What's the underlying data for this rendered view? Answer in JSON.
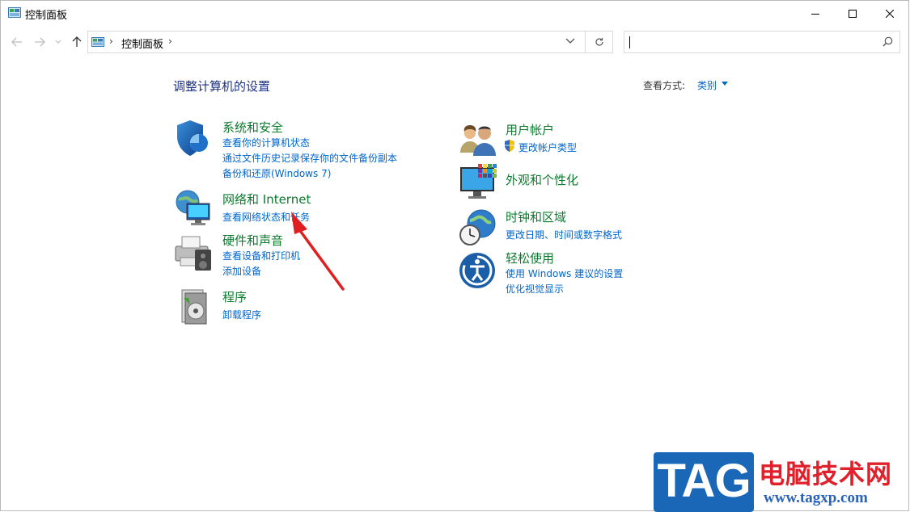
{
  "window": {
    "title": "控制面板",
    "icon": "control-panel-icon"
  },
  "nav": {
    "back": "back-arrow-icon",
    "forward": "forward-arrow-icon",
    "recent": "chevron-down-icon",
    "up": "up-arrow-icon"
  },
  "address": {
    "crumb": "控制面板",
    "separator": "›"
  },
  "search": {
    "placeholder": ""
  },
  "content": {
    "heading": "调整计算机的设置",
    "view_by_label": "查看方式:",
    "view_by_value": "类别"
  },
  "categories": {
    "system": {
      "title": "系统和安全",
      "icon": "shield-pie-icon",
      "links": [
        "查看你的计算机状态",
        "通过文件历史记录保存你的文件备份副本",
        "备份和还原(Windows 7)"
      ]
    },
    "network": {
      "title": "网络和 Internet",
      "icon": "globe-network-icon",
      "links": [
        "查看网络状态和任务"
      ]
    },
    "hardware": {
      "title": "硬件和声音",
      "icon": "printer-speaker-icon",
      "links": [
        "查看设备和打印机",
        "添加设备"
      ]
    },
    "programs": {
      "title": "程序",
      "icon": "programs-disc-icon",
      "links": [
        "卸载程序"
      ]
    },
    "users": {
      "title": "用户帐户",
      "icon": "users-icon",
      "links": [
        "更改帐户类型"
      ]
    },
    "appearance": {
      "title": "外观和个性化",
      "icon": "monitor-palette-icon",
      "links": []
    },
    "clock": {
      "title": "时钟和区域",
      "icon": "globe-clock-icon",
      "links": [
        "更改日期、时间或数字格式"
      ]
    },
    "ease": {
      "title": "轻松使用",
      "icon": "ease-of-access-icon",
      "links": [
        "使用 Windows 建议的设置",
        "优化视觉显示"
      ]
    }
  },
  "watermark": {
    "tag": "TAG",
    "site_name": "电脑技术网",
    "url": "www.tagxp.com"
  },
  "colors": {
    "heading": "#1e3287",
    "category_title": "#0c7a2e",
    "link": "#0066cc",
    "annotation_arrow": "#e02020"
  }
}
